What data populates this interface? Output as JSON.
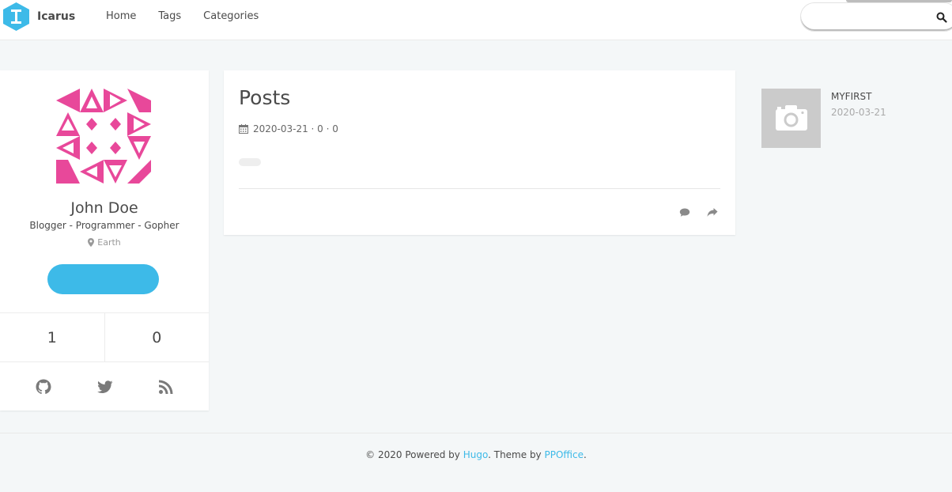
{
  "header": {
    "brand": "Icarus",
    "nav": [
      "Home",
      "Tags",
      "Categories"
    ],
    "search": {
      "value": "",
      "placeholder": ""
    }
  },
  "profile": {
    "name": "John Doe",
    "bio": "Blogger - Programmer - Gopher",
    "location": "Earth",
    "follow_label": "",
    "stats": [
      "1",
      "0"
    ],
    "socials": [
      "github-icon",
      "twitter-icon",
      "rss-icon"
    ]
  },
  "posts": {
    "title": "Posts",
    "meta": "2020-03-21 · 0 · 0",
    "actions": [
      "comment-icon",
      "share-icon"
    ]
  },
  "recent": {
    "title": "MYFIRST",
    "date": "2020-03-21"
  },
  "footer": {
    "prefix": "© 2020 Powered by ",
    "hugo": "Hugo",
    "middle": ". Theme by ",
    "ppoffice": "PPOffice",
    "suffix": "."
  },
  "colors": {
    "accent": "#3dbae8",
    "avatar": "#e8489a",
    "background": "#f4f7f8"
  }
}
